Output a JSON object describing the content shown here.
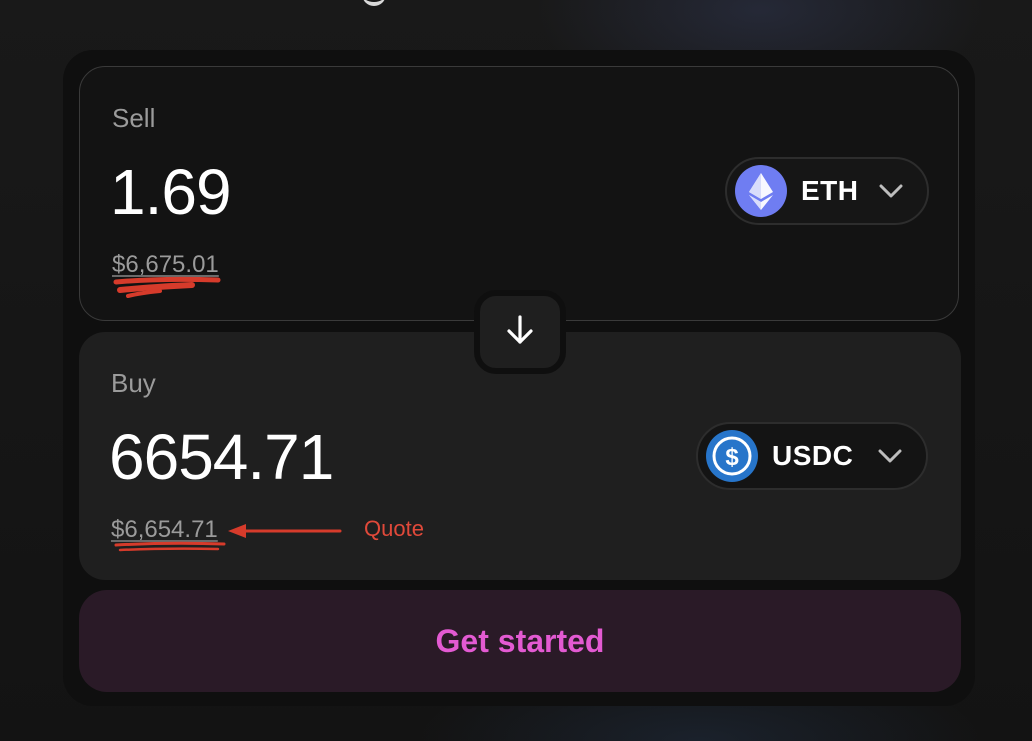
{
  "sell": {
    "label": "Sell",
    "amount": "1.69",
    "fiat_value": "$6,675.01",
    "token": {
      "symbol": "ETH",
      "icon": "eth-icon",
      "color": "#6f7df2"
    }
  },
  "buy": {
    "label": "Buy",
    "amount": "6654.71",
    "fiat_value": "$6,654.71",
    "token": {
      "symbol": "USDC",
      "icon": "usdc-icon",
      "color": "#2775ca"
    }
  },
  "swap_direction_icon": "arrow-down-icon",
  "cta": {
    "label": "Get started",
    "color": "#e35ad2",
    "background": "#2a1a27"
  },
  "annotations": {
    "quote_label": "Quote",
    "color": "#e0493a"
  }
}
